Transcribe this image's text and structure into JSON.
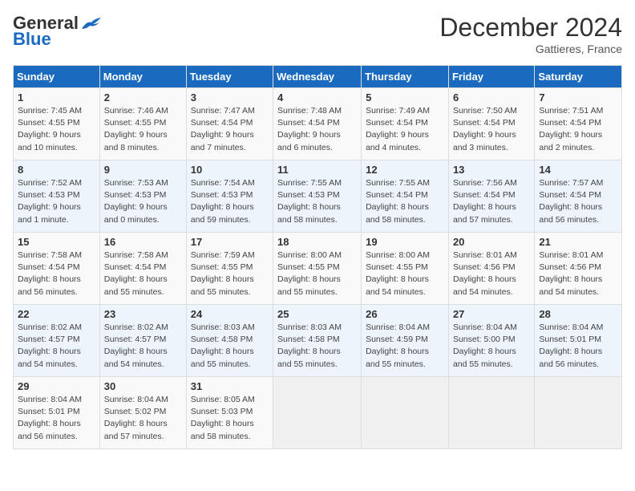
{
  "header": {
    "logo_general": "General",
    "logo_blue": "Blue",
    "month_title": "December 2024",
    "subtitle": "Gattieres, France"
  },
  "weekdays": [
    "Sunday",
    "Monday",
    "Tuesday",
    "Wednesday",
    "Thursday",
    "Friday",
    "Saturday"
  ],
  "weeks": [
    [
      {
        "day": "1",
        "sunrise": "Sunrise: 7:45 AM",
        "sunset": "Sunset: 4:55 PM",
        "daylight": "Daylight: 9 hours and 10 minutes."
      },
      {
        "day": "2",
        "sunrise": "Sunrise: 7:46 AM",
        "sunset": "Sunset: 4:55 PM",
        "daylight": "Daylight: 9 hours and 8 minutes."
      },
      {
        "day": "3",
        "sunrise": "Sunrise: 7:47 AM",
        "sunset": "Sunset: 4:54 PM",
        "daylight": "Daylight: 9 hours and 7 minutes."
      },
      {
        "day": "4",
        "sunrise": "Sunrise: 7:48 AM",
        "sunset": "Sunset: 4:54 PM",
        "daylight": "Daylight: 9 hours and 6 minutes."
      },
      {
        "day": "5",
        "sunrise": "Sunrise: 7:49 AM",
        "sunset": "Sunset: 4:54 PM",
        "daylight": "Daylight: 9 hours and 4 minutes."
      },
      {
        "day": "6",
        "sunrise": "Sunrise: 7:50 AM",
        "sunset": "Sunset: 4:54 PM",
        "daylight": "Daylight: 9 hours and 3 minutes."
      },
      {
        "day": "7",
        "sunrise": "Sunrise: 7:51 AM",
        "sunset": "Sunset: 4:54 PM",
        "daylight": "Daylight: 9 hours and 2 minutes."
      }
    ],
    [
      {
        "day": "8",
        "sunrise": "Sunrise: 7:52 AM",
        "sunset": "Sunset: 4:53 PM",
        "daylight": "Daylight: 9 hours and 1 minute."
      },
      {
        "day": "9",
        "sunrise": "Sunrise: 7:53 AM",
        "sunset": "Sunset: 4:53 PM",
        "daylight": "Daylight: 9 hours and 0 minutes."
      },
      {
        "day": "10",
        "sunrise": "Sunrise: 7:54 AM",
        "sunset": "Sunset: 4:53 PM",
        "daylight": "Daylight: 8 hours and 59 minutes."
      },
      {
        "day": "11",
        "sunrise": "Sunrise: 7:55 AM",
        "sunset": "Sunset: 4:53 PM",
        "daylight": "Daylight: 8 hours and 58 minutes."
      },
      {
        "day": "12",
        "sunrise": "Sunrise: 7:55 AM",
        "sunset": "Sunset: 4:54 PM",
        "daylight": "Daylight: 8 hours and 58 minutes."
      },
      {
        "day": "13",
        "sunrise": "Sunrise: 7:56 AM",
        "sunset": "Sunset: 4:54 PM",
        "daylight": "Daylight: 8 hours and 57 minutes."
      },
      {
        "day": "14",
        "sunrise": "Sunrise: 7:57 AM",
        "sunset": "Sunset: 4:54 PM",
        "daylight": "Daylight: 8 hours and 56 minutes."
      }
    ],
    [
      {
        "day": "15",
        "sunrise": "Sunrise: 7:58 AM",
        "sunset": "Sunset: 4:54 PM",
        "daylight": "Daylight: 8 hours and 56 minutes."
      },
      {
        "day": "16",
        "sunrise": "Sunrise: 7:58 AM",
        "sunset": "Sunset: 4:54 PM",
        "daylight": "Daylight: 8 hours and 55 minutes."
      },
      {
        "day": "17",
        "sunrise": "Sunrise: 7:59 AM",
        "sunset": "Sunset: 4:55 PM",
        "daylight": "Daylight: 8 hours and 55 minutes."
      },
      {
        "day": "18",
        "sunrise": "Sunrise: 8:00 AM",
        "sunset": "Sunset: 4:55 PM",
        "daylight": "Daylight: 8 hours and 55 minutes."
      },
      {
        "day": "19",
        "sunrise": "Sunrise: 8:00 AM",
        "sunset": "Sunset: 4:55 PM",
        "daylight": "Daylight: 8 hours and 54 minutes."
      },
      {
        "day": "20",
        "sunrise": "Sunrise: 8:01 AM",
        "sunset": "Sunset: 4:56 PM",
        "daylight": "Daylight: 8 hours and 54 minutes."
      },
      {
        "day": "21",
        "sunrise": "Sunrise: 8:01 AM",
        "sunset": "Sunset: 4:56 PM",
        "daylight": "Daylight: 8 hours and 54 minutes."
      }
    ],
    [
      {
        "day": "22",
        "sunrise": "Sunrise: 8:02 AM",
        "sunset": "Sunset: 4:57 PM",
        "daylight": "Daylight: 8 hours and 54 minutes."
      },
      {
        "day": "23",
        "sunrise": "Sunrise: 8:02 AM",
        "sunset": "Sunset: 4:57 PM",
        "daylight": "Daylight: 8 hours and 54 minutes."
      },
      {
        "day": "24",
        "sunrise": "Sunrise: 8:03 AM",
        "sunset": "Sunset: 4:58 PM",
        "daylight": "Daylight: 8 hours and 55 minutes."
      },
      {
        "day": "25",
        "sunrise": "Sunrise: 8:03 AM",
        "sunset": "Sunset: 4:58 PM",
        "daylight": "Daylight: 8 hours and 55 minutes."
      },
      {
        "day": "26",
        "sunrise": "Sunrise: 8:04 AM",
        "sunset": "Sunset: 4:59 PM",
        "daylight": "Daylight: 8 hours and 55 minutes."
      },
      {
        "day": "27",
        "sunrise": "Sunrise: 8:04 AM",
        "sunset": "Sunset: 5:00 PM",
        "daylight": "Daylight: 8 hours and 55 minutes."
      },
      {
        "day": "28",
        "sunrise": "Sunrise: 8:04 AM",
        "sunset": "Sunset: 5:01 PM",
        "daylight": "Daylight: 8 hours and 56 minutes."
      }
    ],
    [
      {
        "day": "29",
        "sunrise": "Sunrise: 8:04 AM",
        "sunset": "Sunset: 5:01 PM",
        "daylight": "Daylight: 8 hours and 56 minutes."
      },
      {
        "day": "30",
        "sunrise": "Sunrise: 8:04 AM",
        "sunset": "Sunset: 5:02 PM",
        "daylight": "Daylight: 8 hours and 57 minutes."
      },
      {
        "day": "31",
        "sunrise": "Sunrise: 8:05 AM",
        "sunset": "Sunset: 5:03 PM",
        "daylight": "Daylight: 8 hours and 58 minutes."
      },
      null,
      null,
      null,
      null
    ]
  ]
}
